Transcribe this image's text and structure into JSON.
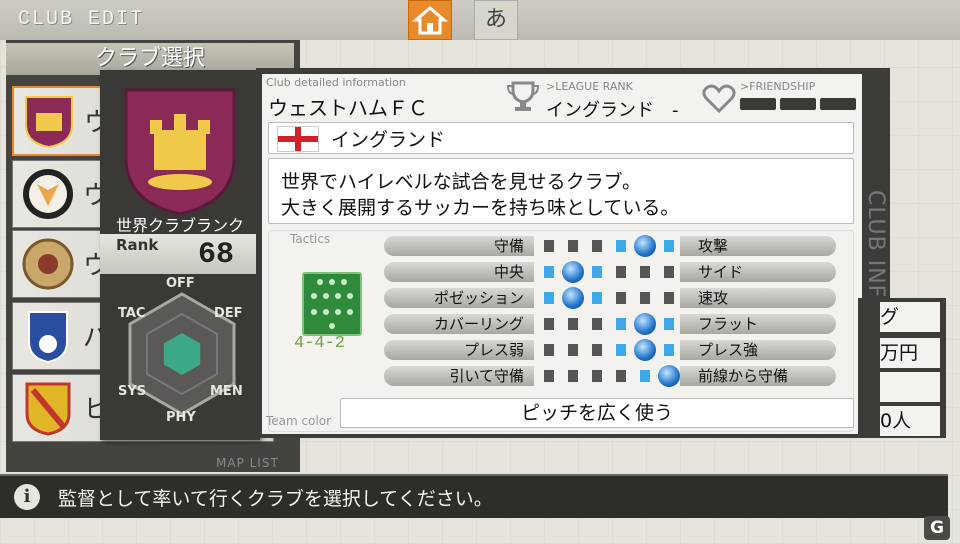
{
  "header": {
    "title": "CLUB EDIT",
    "kana_button": "あ",
    "home_icon": "home-icon"
  },
  "club_list": {
    "header": "クラブ選択",
    "items": [
      {
        "kana": "ウ",
        "crest": "golazo-crest"
      },
      {
        "kana": "ウ",
        "crest": "fox-crest"
      },
      {
        "kana": "ウ",
        "crest": "ornate-crest"
      },
      {
        "kana": "バ",
        "crest": "blue-bird-crest"
      },
      {
        "kana": "ヒ",
        "crest": "yellow-red-crest"
      }
    ],
    "map_list_label": "MAP LIST"
  },
  "crest_panel": {
    "world_rank_label": "世界クラブランク",
    "rank_label": "Rank",
    "rank_value": "68",
    "radar_labels": {
      "off": "OFF",
      "def": "DEF",
      "men": "MEN",
      "phy": "PHY",
      "sys": "SYS",
      "tac": "TAC"
    },
    "radar_values": {
      "off": 0.35,
      "def": 0.35,
      "men": 0.35,
      "phy": 0.35,
      "sys": 0.35,
      "tac": 0.35
    }
  },
  "info": {
    "caption": "Club detailed information",
    "club_name": "ウェストハムＦＣ",
    "league_caption": ">LEAGUE RANK",
    "league_value": "イングランド　-",
    "friendship_caption": ">FRIENDSHIP",
    "friendship_level": 0,
    "country": "イングランド",
    "description": [
      "世界でハイレベルな試合を見せるクラブ。",
      "大きく展開するサッカーを持ち味としている。"
    ],
    "tactics_caption": "Tactics",
    "formation": "4-4-2",
    "team_color_label": "Team color",
    "pitch_note": "ピッチを広く使う",
    "side_label": "CLUB INFOMATION",
    "tactics": [
      {
        "left": "守備",
        "right": "攻撃",
        "position": 4
      },
      {
        "left": "中央",
        "right": "サイド",
        "position": 1
      },
      {
        "left": "ポゼッション",
        "right": "速攻",
        "position": 1
      },
      {
        "left": "カバーリング",
        "right": "フラット",
        "position": 4
      },
      {
        "left": "プレス弱",
        "right": "プレス強",
        "position": 4
      },
      {
        "left": "引いて守備",
        "right": "前線から守備",
        "position": 5
      }
    ]
  },
  "right_peek": [
    "グ",
    "万円",
    "",
    "0人"
  ],
  "help": {
    "text": "監督として率いて行くクラブを選択してください。",
    "icon": "info-icon"
  },
  "watermark": "G"
}
